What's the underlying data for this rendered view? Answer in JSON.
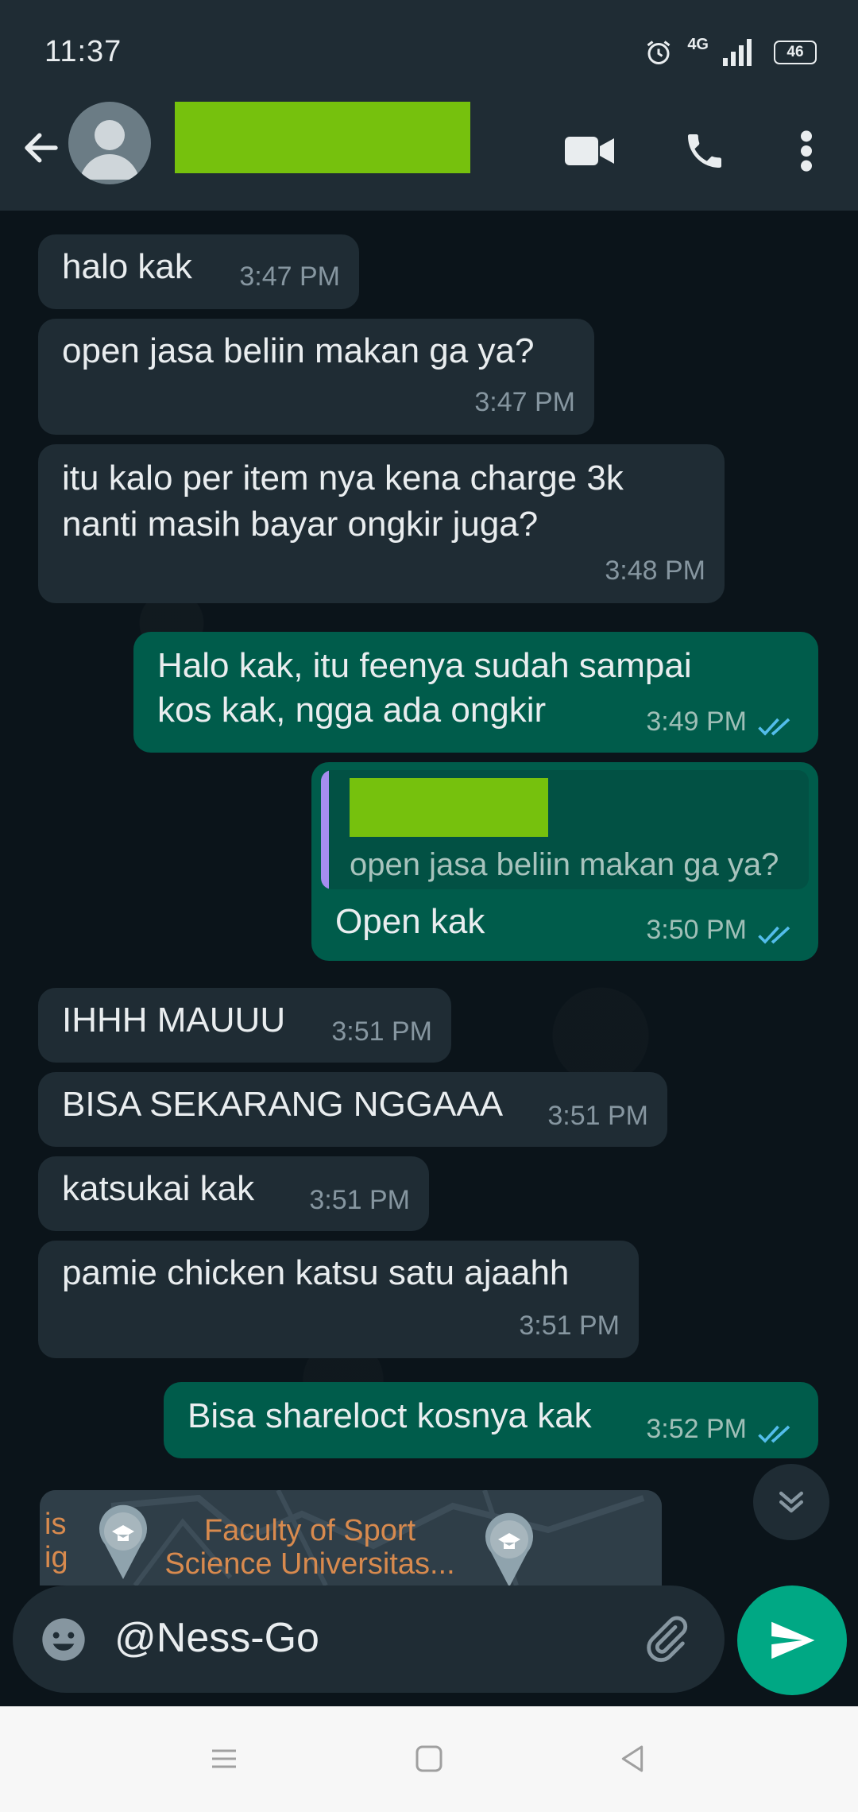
{
  "status_bar": {
    "time": "11:37",
    "network": "4G",
    "battery": "46"
  },
  "header": {
    "back_icon": "arrow-left-icon",
    "contact_name": "",
    "actions": [
      "video-call-icon",
      "phone-icon",
      "more-vert-icon"
    ]
  },
  "messages": [
    {
      "dir": "in",
      "text": "halo kak",
      "time": "3:47 PM"
    },
    {
      "dir": "in",
      "text": "open jasa beliin makan ga ya?",
      "time": "3:47 PM"
    },
    {
      "dir": "in",
      "lines": [
        "itu kalo per item nya kena charge 3k",
        "nanti masih bayar ongkir juga?"
      ],
      "time": "3:48 PM"
    },
    {
      "dir": "out",
      "lines": [
        "Halo kak, itu feenya sudah sampai",
        "kos kak, ngga ada ongkir"
      ],
      "time": "3:49 PM",
      "status": "read"
    },
    {
      "dir": "out",
      "quote": {
        "author": "",
        "text": "open jasa beliin makan ga ya?"
      },
      "text": "Open kak",
      "time": "3:50 PM",
      "status": "read"
    },
    {
      "dir": "in",
      "text": "IHHH MAUUU",
      "time": "3:51 PM"
    },
    {
      "dir": "in",
      "text": "BISA SEKARANG NGGAAA",
      "time": "3:51 PM"
    },
    {
      "dir": "in",
      "text": "katsukai kak",
      "time": "3:51 PM"
    },
    {
      "dir": "in",
      "text": "pamie chicken katsu satu ajaahh",
      "time": "3:51 PM"
    },
    {
      "dir": "out",
      "text": "Bisa shareloct kosnya kak",
      "time": "3:52 PM",
      "status": "read"
    }
  ],
  "location_preview": {
    "left_label": [
      "is",
      "ig"
    ],
    "place_label": [
      "Faculty of Sport",
      "Science Universitas..."
    ]
  },
  "composer": {
    "text": "@Ness-Go",
    "emoji_icon": "emoji-icon",
    "attach_icon": "paperclip-icon",
    "send_icon": "send-icon"
  },
  "colors": {
    "incoming": "#1f2c34",
    "outgoing": "#005c4b",
    "read_ticks": "#53bdeb",
    "accent": "#00a884",
    "redaction": "#76c10d"
  }
}
